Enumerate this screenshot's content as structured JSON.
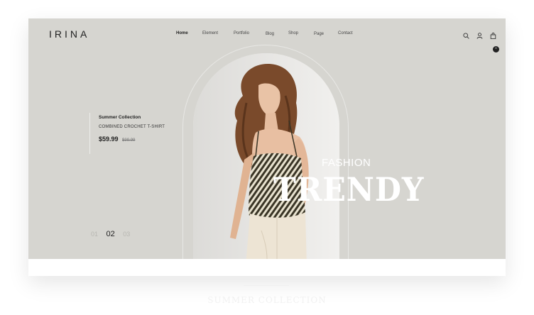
{
  "brand": {
    "logo": "IRINA"
  },
  "nav": {
    "items": [
      "Home",
      "Element",
      "Portfolio",
      "Blog",
      "Shop",
      "Page",
      "Contact"
    ]
  },
  "header_icons": {
    "search": "search-icon",
    "account": "user-icon",
    "cart": "cart-icon",
    "cart_count": "0"
  },
  "hero": {
    "product": {
      "collection": "Summer Collection",
      "name": "COMBINED CROCHET T-SHIRT",
      "price": "$59.99",
      "old_price": "$99.99"
    },
    "slides": {
      "items": [
        "01",
        "02",
        "03"
      ],
      "active": "02"
    },
    "overlay_small": "FASHION",
    "overlay_big": "TRENDY"
  },
  "below": {
    "ghost_heading": "SUMMER COLLECTION"
  },
  "colors": {
    "hero_bg": "#d6d5d0",
    "text_dark": "#222222",
    "overlay_text": "#ffffff"
  }
}
